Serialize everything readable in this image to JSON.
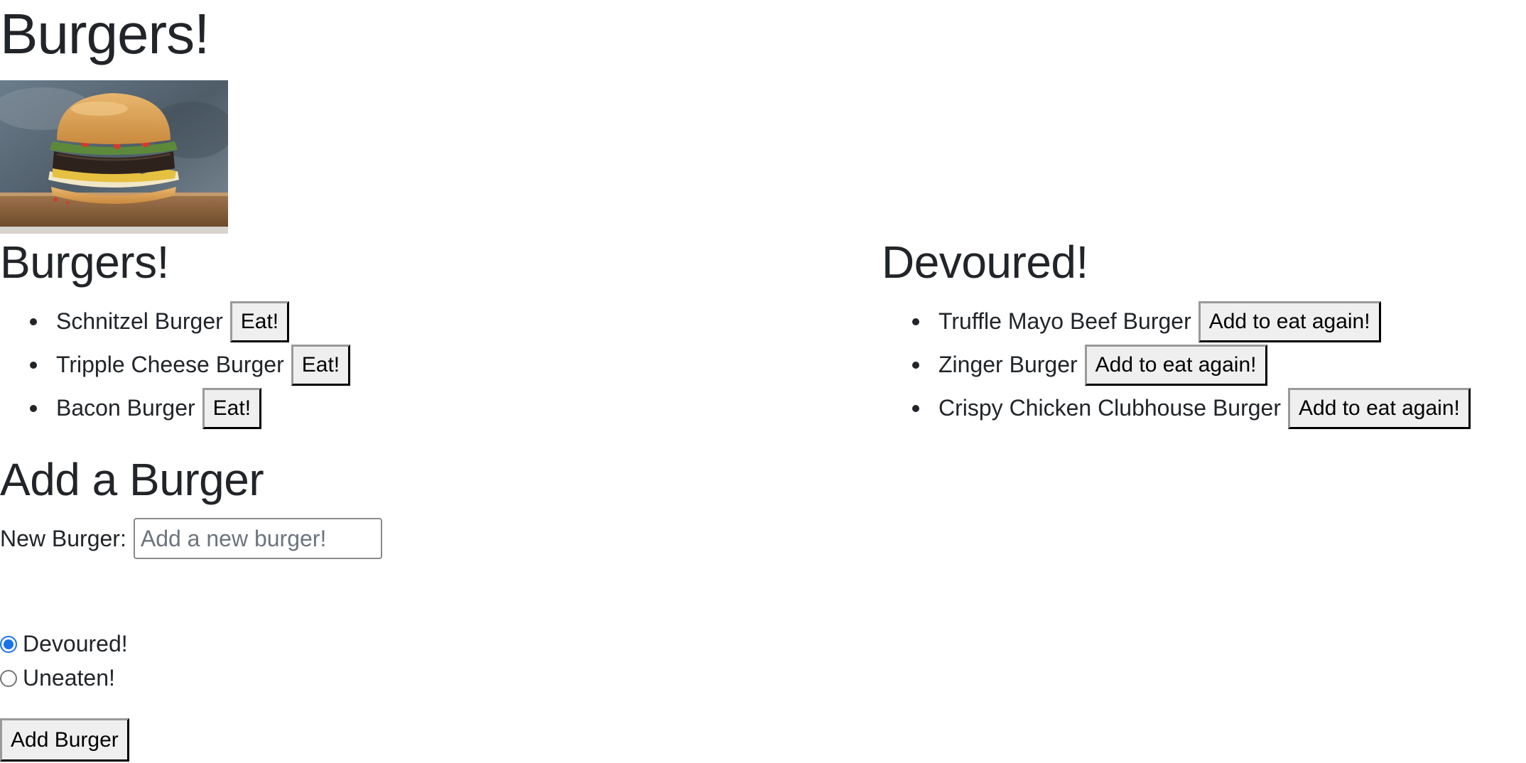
{
  "header": {
    "title": "Burgers!"
  },
  "uneaten": {
    "heading": "Burgers!",
    "items": [
      {
        "name": "Schnitzel Burger",
        "button": "Eat!"
      },
      {
        "name": "Tripple Cheese Burger",
        "button": "Eat!"
      },
      {
        "name": "Bacon Burger",
        "button": "Eat!"
      }
    ]
  },
  "devoured": {
    "heading": "Devoured!",
    "items": [
      {
        "name": "Truffle Mayo Beef Burger",
        "button": "Add to eat again!"
      },
      {
        "name": "Zinger Burger",
        "button": "Add to eat again!"
      },
      {
        "name": "Crispy Chicken Clubhouse Burger",
        "button": "Add to eat again!"
      }
    ]
  },
  "form": {
    "heading": "Add a Burger",
    "input_label": "New Burger:",
    "input_value": "",
    "input_placeholder": "Add a new burger!",
    "radio_options": [
      {
        "label": "Devoured!",
        "checked": true
      },
      {
        "label": "Uneaten!",
        "checked": false
      }
    ],
    "submit_label": "Add Burger"
  },
  "colors": {
    "text": "#212529",
    "radio_accent": "#1a73e8",
    "button_bg": "#efefef"
  },
  "icons": {
    "list_bullet": "bullet-icon"
  }
}
